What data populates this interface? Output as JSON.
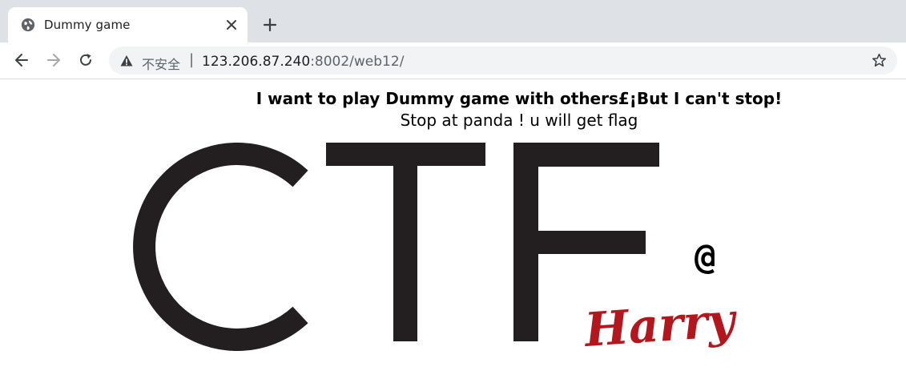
{
  "browser": {
    "tab": {
      "title": "Dummy game",
      "favicon": "globe-icon",
      "close_icon": "close-icon"
    },
    "new_tab_icon": "plus-icon",
    "toolbar": {
      "back_icon": "back-arrow-icon",
      "forward_icon": "forward-arrow-icon",
      "reload_icon": "reload-icon",
      "security_icon": "warning-triangle-icon",
      "security_text": "不安全",
      "separator": "|",
      "url_host": "123.206.87.240",
      "url_rest": ":8002/web12/",
      "bookmark_icon": "star-icon"
    }
  },
  "page": {
    "headline": "I want to play Dummy game with others£¡But I can't stop!",
    "subline": "Stop at panda ! u will get flag",
    "logo": {
      "text": "CTF",
      "at_sign": "@",
      "signature": "Harry",
      "signature_color": "#b3171d"
    }
  }
}
